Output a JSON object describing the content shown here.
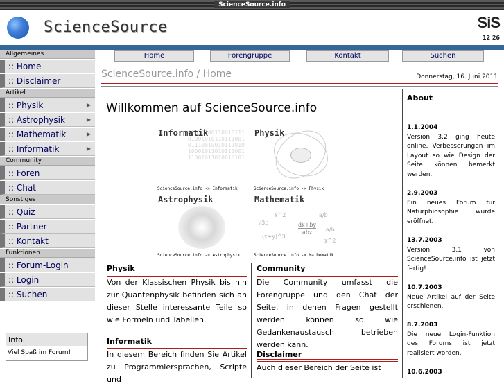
{
  "window": {
    "title": "ScienceSource.info"
  },
  "header": {
    "logo_text": "ScienceSource",
    "badge": "SiS",
    "badge_sub": "12 26"
  },
  "sidebar": {
    "sections": [
      {
        "title": "Allgemeines",
        "items": [
          {
            "label": ":: Home"
          },
          {
            "label": ":: Disclaimer"
          }
        ]
      },
      {
        "title": "Artikel",
        "items": [
          {
            "label": ":: Physik",
            "arrow": "▶"
          },
          {
            "label": ":: Astrophysik",
            "arrow": "▶"
          },
          {
            "label": ":: Mathematik",
            "arrow": "▶"
          },
          {
            "label": ":: Informatik",
            "arrow": "▶"
          }
        ]
      },
      {
        "title": "Community",
        "items": [
          {
            "label": ":: Foren"
          },
          {
            "label": ":: Chat"
          }
        ]
      },
      {
        "title": "Sonstiges",
        "items": [
          {
            "label": ":: Quiz"
          },
          {
            "label": ":: Partner"
          },
          {
            "label": ":: Kontakt"
          }
        ]
      },
      {
        "title": "Funktionen",
        "items": [
          {
            "label": ":: Forum-Login"
          },
          {
            "label": ":: Login"
          },
          {
            "label": ":: Suchen"
          }
        ]
      }
    ],
    "info": {
      "title": "Info",
      "text": "Viel Spaß im Forum!"
    }
  },
  "nav": {
    "items": [
      {
        "label": "Home"
      },
      {
        "label": "Forengruppe"
      },
      {
        "label": "Kontakt"
      },
      {
        "label": "Suchen"
      }
    ]
  },
  "breadcrumb": "ScienceSource.info / Home",
  "date": "Donnerstag, 16. Juni 2011",
  "main": {
    "heading": "Willkommen auf ScienceSource.info",
    "tiles": [
      {
        "title": "Informatik",
        "caption": "ScienceSource.info -> Informatik",
        "bits": "0101010011001011101001010110111001011100100101110101000101101011100111001011010010101"
      },
      {
        "title": "Physik",
        "caption": "ScienceSource.info -> Physik"
      },
      {
        "title": "Astrophysik",
        "caption": "ScienceSource.info -> Astrophysik"
      },
      {
        "title": "Mathematik",
        "caption": "ScienceSource.info -> Mathematik",
        "f1": "x^2",
        "f2": "a/b",
        "f3": "√3b",
        "f4": "dx+by",
        "f5": "abz",
        "f6": "a/b",
        "f7": "(x+y)^3",
        "f8": "x^2"
      }
    ],
    "left_col": [
      {
        "title": "Physik",
        "text": "Von der Klassischen Physik bis hin zur Quantenphysik befinden sich an dieser Stelle interessante Teile so wie Formeln und Tabellen."
      },
      {
        "title": "Informatik",
        "text": "In diesem Bereich finden Sie Artikel zu Programmiersprachen, Scripte und"
      }
    ],
    "right_col": [
      {
        "title": "Community",
        "text": "Die Community umfasst die Forengruppe und den Chat der Seite, in denen Fragen gestellt werden können so wie Gedankenaustausch betrieben werden kann."
      },
      {
        "title": "Disclaimer",
        "text": "Auch dieser Bereich der Seite ist"
      }
    ]
  },
  "about": {
    "title": "About",
    "news": [
      {
        "date": "1.1.2004",
        "text": "Version 3.2 ging heute online, Verbesserungen im Layout so wie Design der Seite können bemerkt werden."
      },
      {
        "date": "2.9.2003",
        "text": "Ein neues Forum für Naturphiosophie wurde eröffnet."
      },
      {
        "date": "13.7.2003",
        "text": "Version 3.1 von ScienceSource.info ist jetzt fertig!"
      },
      {
        "date": "10.7.2003",
        "text": "Neue Artikel auf der Seite erschienen."
      },
      {
        "date": "8.7.2003",
        "text": "Die neue Login-Funktion des Forums ist jetzt realisiert worden."
      },
      {
        "date": "10.6.2003",
        "text": ""
      }
    ]
  }
}
